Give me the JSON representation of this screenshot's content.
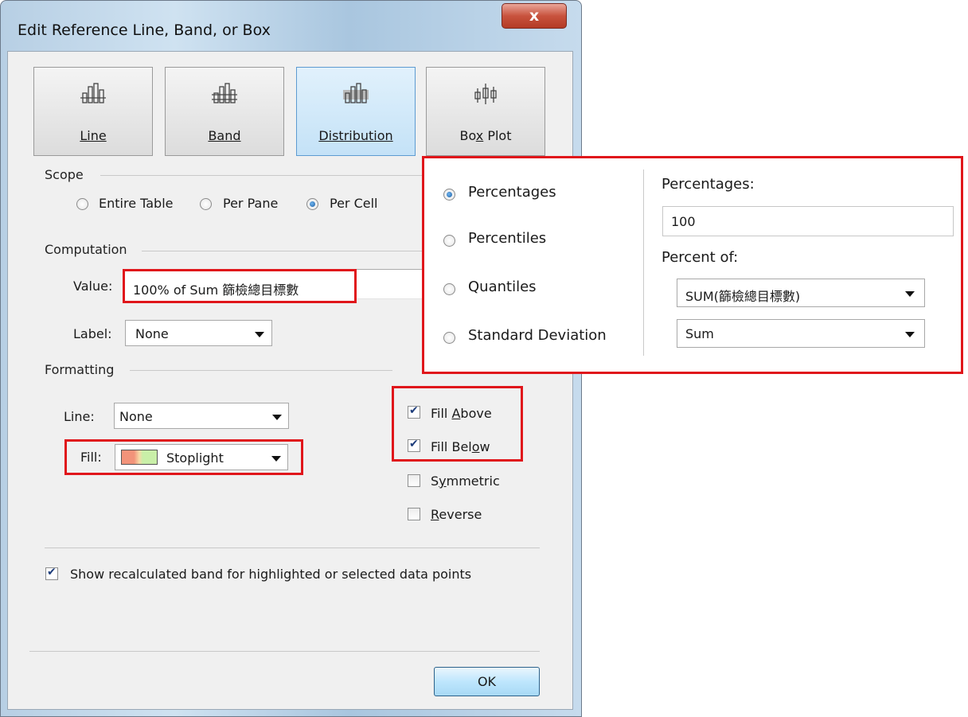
{
  "window": {
    "title": "Edit Reference Line, Band, or Box",
    "close_label": "x"
  },
  "tabs": [
    {
      "label": "Line",
      "icon": "line-chart-icon",
      "selected": false
    },
    {
      "label": "Band",
      "icon": "band-chart-icon",
      "selected": false
    },
    {
      "label": "Distribution",
      "icon": "distribution-chart-icon",
      "selected": true
    },
    {
      "label": "Box Plot",
      "icon": "box-plot-icon",
      "selected": false
    }
  ],
  "scope": {
    "title": "Scope",
    "options": [
      {
        "label": "Entire Table",
        "selected": false
      },
      {
        "label": "Per Pane",
        "selected": false
      },
      {
        "label": "Per Cell",
        "selected": true
      }
    ]
  },
  "computation": {
    "title": "Computation",
    "value_label": "Value:",
    "value": "100% of Sum 篩檢總目標數",
    "label_label": "Label:",
    "label_value": "None"
  },
  "formatting": {
    "title": "Formatting",
    "line_label": "Line:",
    "line_value": "None",
    "fill_label": "Fill:",
    "fill_value": "Stoplight",
    "fill_colors": [
      "#f2937a",
      "#f7d9a6",
      "#c9efa8"
    ],
    "checkboxes": [
      {
        "label": "Fill Above",
        "checked": true
      },
      {
        "label": "Fill Below",
        "checked": true
      },
      {
        "label": "Symmetric",
        "checked": false
      },
      {
        "label": "Reverse",
        "checked": false
      }
    ]
  },
  "show_recalculated": {
    "label": "Show recalculated band for highlighted or selected data points",
    "checked": true
  },
  "ok_label": "OK",
  "distribution_panel": {
    "options": [
      {
        "label": "Percentages",
        "selected": true
      },
      {
        "label": "Percentiles",
        "selected": false
      },
      {
        "label": "Quantiles",
        "selected": false
      },
      {
        "label": "Standard Deviation",
        "selected": false
      }
    ],
    "percentages_label": "Percentages:",
    "percentages_value": "100",
    "percent_of_label": "Percent of:",
    "percent_of_value": "SUM(篩檢總目標數)",
    "aggregation_value": "Sum"
  },
  "colors": {
    "highlight_red": "#e0161b",
    "selected_tile": "#c4e2f7",
    "radio_dot": "#1d5fa4"
  }
}
